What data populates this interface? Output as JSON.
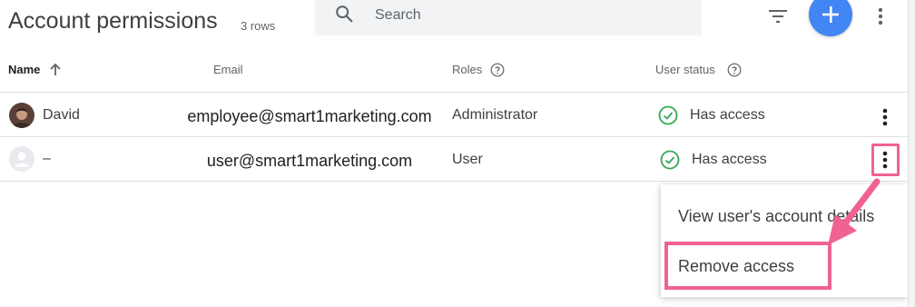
{
  "header": {
    "title": "Account permissions",
    "row_count": "3 rows",
    "search_placeholder": "Search"
  },
  "table": {
    "columns": {
      "name": "Name",
      "email": "Email",
      "roles": "Roles",
      "status": "User status"
    },
    "rows": [
      {
        "name": "David",
        "email": "employee@smart1marketing.com",
        "role": "Administrator",
        "status": "Has access"
      },
      {
        "name": "–",
        "email": "user@smart1marketing.com",
        "role": "User",
        "status": "Has access"
      }
    ]
  },
  "context_menu": {
    "items": [
      {
        "label": "View user's account details"
      },
      {
        "label": "Remove access"
      }
    ]
  },
  "colors": {
    "accent": "#4285f4",
    "success": "#34a853",
    "annotation": "#f06292"
  },
  "icons": [
    "search-icon",
    "filter-icon",
    "add-icon",
    "more-vert-icon",
    "arrow-upward-icon",
    "help-icon",
    "check-circle-icon",
    "avatar-icon"
  ]
}
